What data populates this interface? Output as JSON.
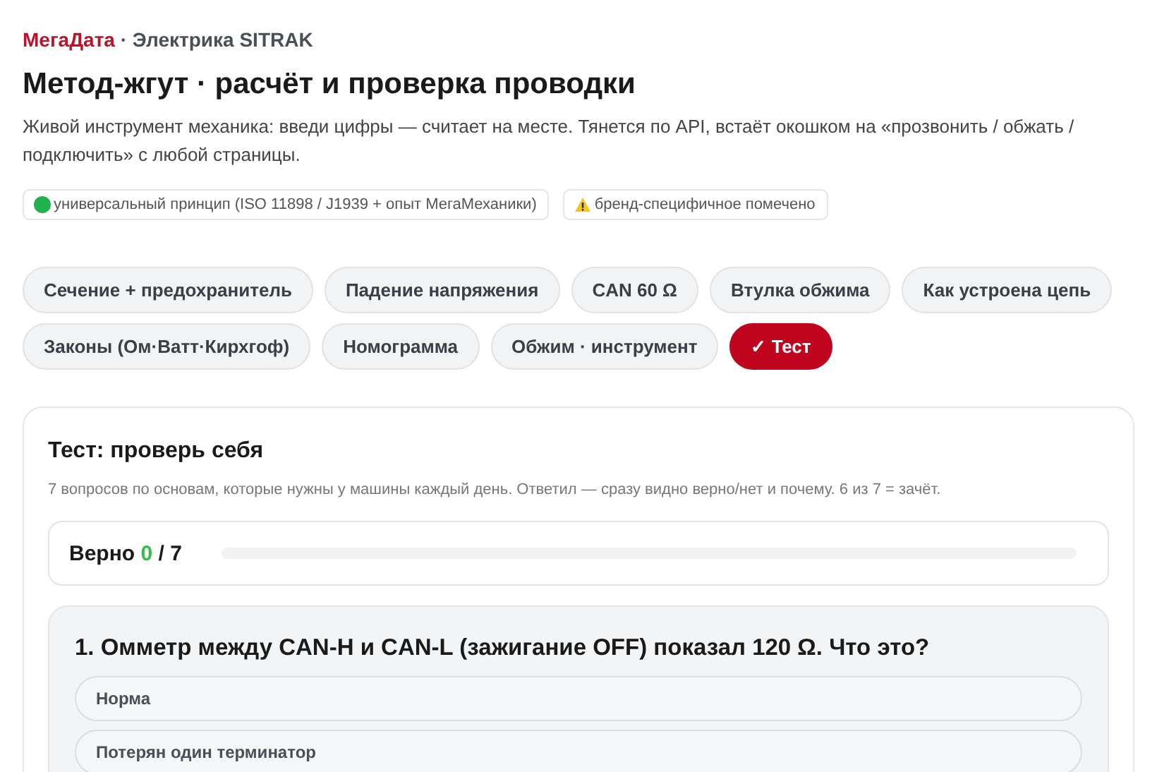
{
  "header": {
    "brand": "МегаДата",
    "section": "· Электрика SITRAK"
  },
  "title": "Метод-жгут · расчёт и проверка проводки",
  "description": "Живой инструмент механика: введи цифры — считает на месте. Тянется по API, встаёт окошком на «прозвонить / обжать / подключить» с любой страницы.",
  "badges": [
    {
      "kind": "universal",
      "label": "универсальный принцип (ISO 11898 / J1939 + опыт МегаМеханики)"
    },
    {
      "kind": "warning",
      "label": "бренд-специфичное помечено"
    }
  ],
  "tabs": [
    {
      "label": "Сечение + предохранитель",
      "selected": false
    },
    {
      "label": "Падение напряжения",
      "selected": false
    },
    {
      "label": "CAN 60 Ω",
      "selected": false
    },
    {
      "label": "Втулка обжима",
      "selected": false
    },
    {
      "label": "Как устроена цепь",
      "selected": false
    },
    {
      "label": "Законы (Ом·Ватт·Кирхгоф)",
      "selected": false
    },
    {
      "label": "Номограмма",
      "selected": false
    },
    {
      "label": "Обжим · инструмент",
      "selected": false
    },
    {
      "label": "✓ Тест",
      "selected": true
    }
  ],
  "quiz": {
    "title": "Тест: проверь себя",
    "subtitle": "7 вопросов по основам, которые нужны у машины каждый день. Ответил — сразу видно верно/нет и почему. 6 из 7 = зачёт.",
    "score": {
      "label": "Верно",
      "correct": "0",
      "total": "/ 7",
      "level": 0
    },
    "question": {
      "text": "1. Омметр между CAN-H и CAN-L (зажигание OFF) показал 120 Ω. Что это?",
      "options": [
        {
          "label": "Норма",
          "selected": false
        },
        {
          "label": "Потерян один терминатор",
          "selected": false
        }
      ]
    }
  }
}
